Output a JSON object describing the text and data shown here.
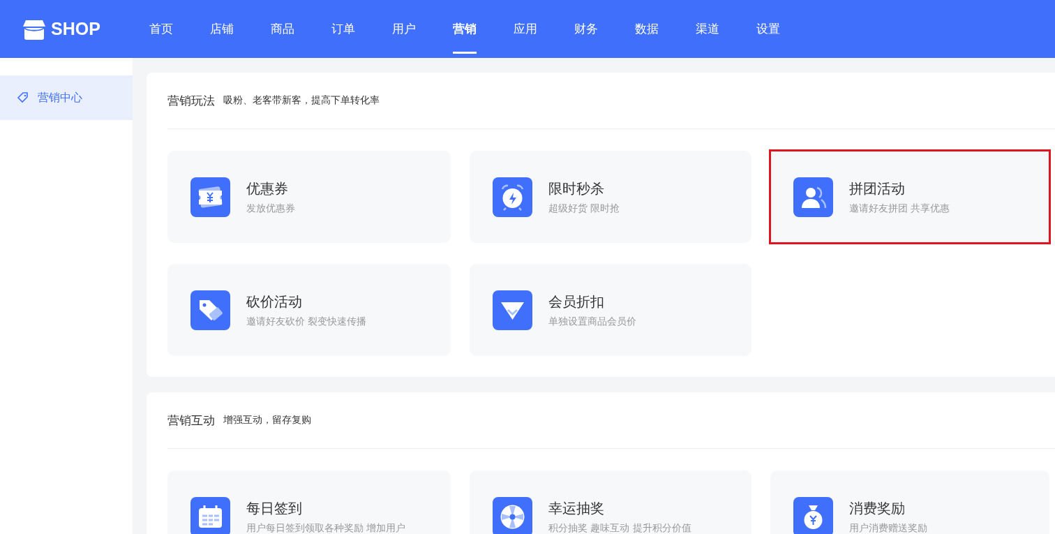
{
  "header": {
    "logo": "SHOP",
    "nav": [
      {
        "label": "首页",
        "selected": false
      },
      {
        "label": "店铺",
        "selected": false
      },
      {
        "label": "商品",
        "selected": false
      },
      {
        "label": "订单",
        "selected": false
      },
      {
        "label": "用户",
        "selected": false
      },
      {
        "label": "营销",
        "selected": true
      },
      {
        "label": "应用",
        "selected": false
      },
      {
        "label": "财务",
        "selected": false
      },
      {
        "label": "数据",
        "selected": false
      },
      {
        "label": "渠道",
        "selected": false
      },
      {
        "label": "设置",
        "selected": false
      }
    ]
  },
  "sidebar": {
    "items": [
      {
        "label": "营销中心",
        "selected": true
      }
    ]
  },
  "sections": [
    {
      "title": "营销玩法",
      "subtitle": "吸粉、老客带新客，提高下单转化率",
      "cards": [
        {
          "kind": "coupon",
          "title": "优惠券",
          "subtitle": "发放优惠券",
          "highlighted": false
        },
        {
          "kind": "alarm",
          "title": "限时秒杀",
          "subtitle": "超级好货 限时抢",
          "highlighted": false
        },
        {
          "kind": "group",
          "title": "拼团活动",
          "subtitle": "邀请好友拼团 共享优惠",
          "highlighted": true
        },
        {
          "kind": "tag",
          "title": "砍价活动",
          "subtitle": "邀请好友砍价 裂变快速传播",
          "highlighted": false
        },
        {
          "kind": "diamond",
          "title": "会员折扣",
          "subtitle": "单独设置商品会员价",
          "highlighted": false
        }
      ]
    },
    {
      "title": "营销互动",
      "subtitle": "增强互动，留存复购",
      "cards": [
        {
          "kind": "calendar",
          "title": "每日签到",
          "subtitle": "用户每日签到领取各种奖励 增加用户",
          "highlighted": false
        },
        {
          "kind": "wheel",
          "title": "幸运抽奖",
          "subtitle": "积分抽奖 趣味互动 提升积分价值",
          "highlighted": false
        },
        {
          "kind": "moneybag",
          "title": "消费奖励",
          "subtitle": "用户消费赠送奖励",
          "highlighted": false
        }
      ]
    }
  ]
}
